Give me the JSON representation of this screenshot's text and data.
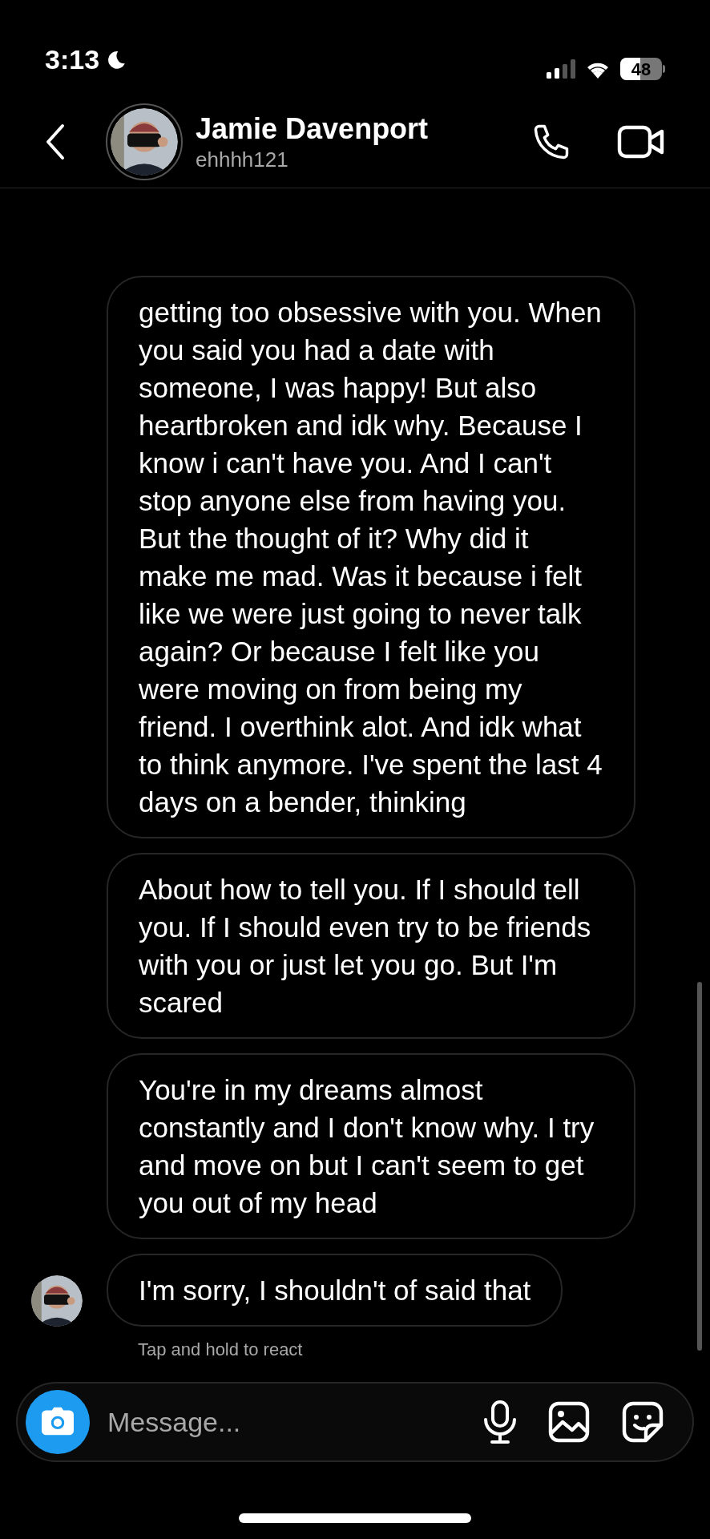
{
  "status_bar": {
    "time": "3:13",
    "battery": "48"
  },
  "header": {
    "name": "Jamie Davenport",
    "username": "ehhhh121"
  },
  "messages": [
    {
      "text": "getting too obsessive with you. When you said you had a date with someone, I was happy! But also heartbroken and idk why. Because I know i can't have you. And I can't stop anyone else from having you. But the thought of it? Why did it make me mad. Was it because i felt like we were just going to never talk again? Or because I felt like you were moving on from being my friend. I overthink alot. And idk what to think anymore. I've spent the last 4 days on a bender, thinking",
      "avatar": false
    },
    {
      "text": "About how to tell you. If I should tell you. If I should even try to be friends with you or just let you go. But I'm scared",
      "avatar": false
    },
    {
      "text": "You're in my dreams almost constantly and I don't know why. I try and move on but I can't seem to get you out of my head",
      "avatar": false
    },
    {
      "text": "I'm sorry, I shouldn't of said that",
      "avatar": true
    }
  ],
  "hint": "Tap and hold to react",
  "composer": {
    "placeholder": "Message..."
  }
}
